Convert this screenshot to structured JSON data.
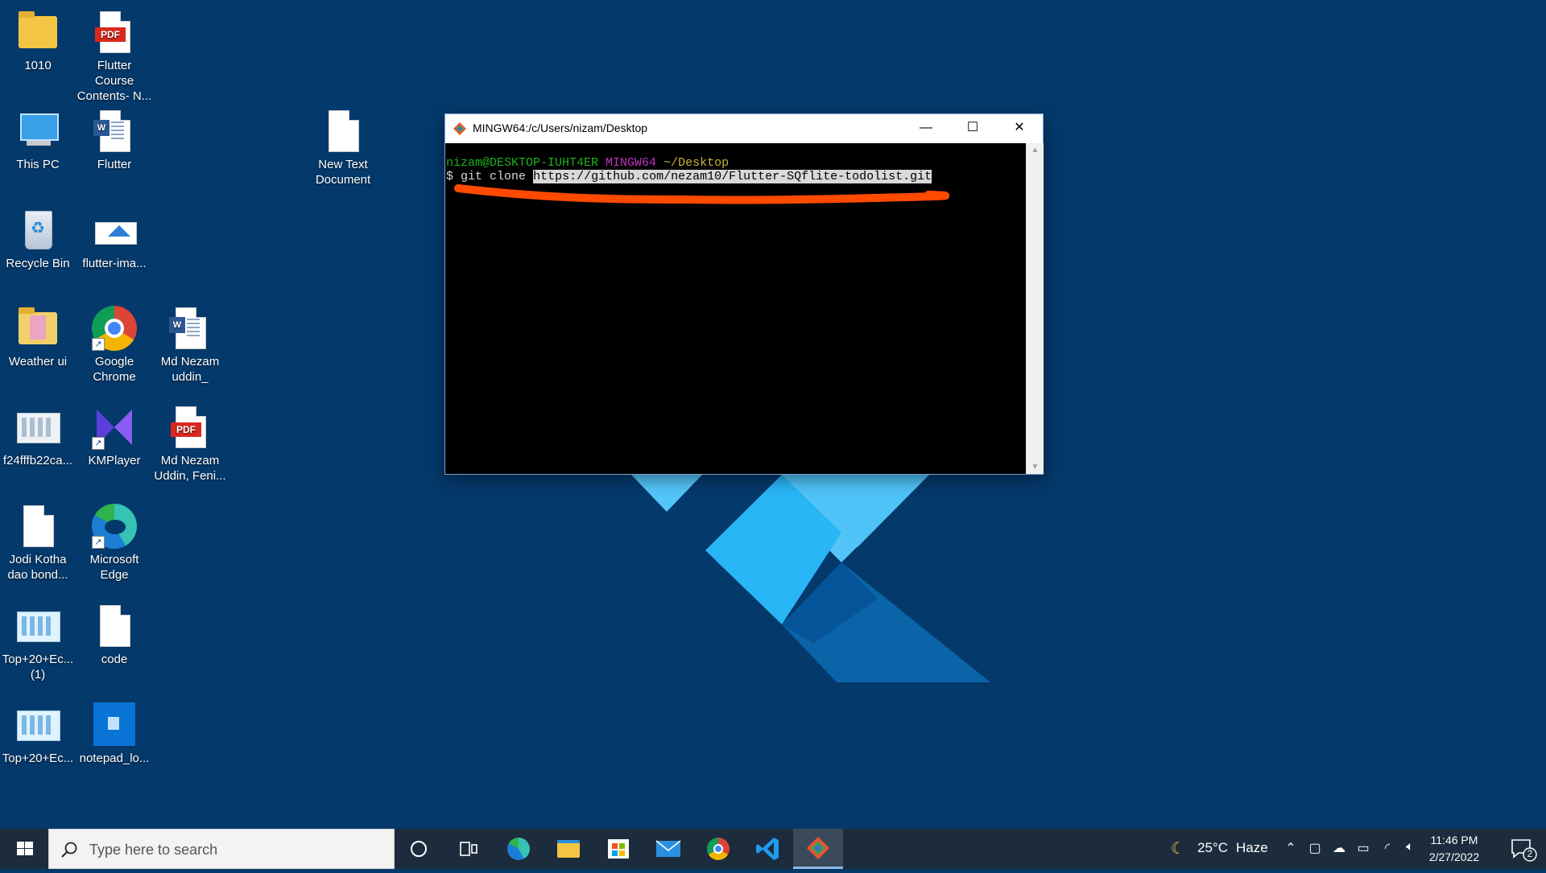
{
  "desktop_icons": [
    {
      "label": "1010"
    },
    {
      "label": "Flutter Course Contents- N..."
    },
    {
      "label": "This PC"
    },
    {
      "label": "Flutter"
    },
    {
      "label": "New Text Document"
    },
    {
      "label": "Recycle Bin"
    },
    {
      "label": "flutter-ima..."
    },
    {
      "label": "Weather ui"
    },
    {
      "label": "Google Chrome"
    },
    {
      "label": "Md Nezam uddin_"
    },
    {
      "label": "f24fffb22ca..."
    },
    {
      "label": "KMPlayer"
    },
    {
      "label": "Md Nezam Uddin, Feni..."
    },
    {
      "label": "Jodi Kotha dao bond..."
    },
    {
      "label": "Microsoft Edge"
    },
    {
      "label": "Top+20+Ec... (1)"
    },
    {
      "label": "code"
    },
    {
      "label": "Top+20+Ec..."
    },
    {
      "label": "notepad_lo..."
    }
  ],
  "terminal": {
    "title": "MINGW64:/c/Users/nizam/Desktop",
    "prompt_user": "nizam@DESKTOP-IUHT4ER",
    "prompt_env": "MINGW64",
    "prompt_path": "~/Desktop",
    "prompt_symbol": "$",
    "command": "git clone",
    "url": "https://github.com/nezam10/Flutter-SQflite-todolist.git",
    "annotation_color": "#ff4a00"
  },
  "taskbar": {
    "search_placeholder": "Type here to search",
    "weather_temp": "25°C",
    "weather_desc": "Haze",
    "time": "11:46 PM",
    "date": "2/27/2022",
    "notification_count": "2"
  },
  "icons": {
    "start": "windows-logo-icon",
    "search": "magnifier-icon",
    "cortana": "circle-icon",
    "task_view": "task-view-icon",
    "pinned": [
      "edge-icon",
      "file-explorer-icon",
      "store-icon",
      "mail-icon",
      "chrome-icon",
      "vscode-icon",
      "git-bash-icon"
    ]
  }
}
